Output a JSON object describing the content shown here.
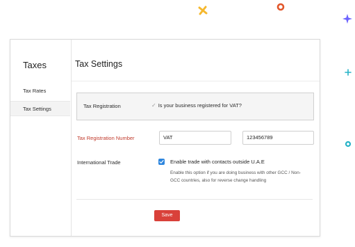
{
  "sidebar": {
    "title": "Taxes",
    "items": [
      {
        "label": "Tax Rates",
        "active": false
      },
      {
        "label": "Tax Settings",
        "active": true
      }
    ]
  },
  "main": {
    "title": "Tax Settings",
    "tax_registration": {
      "label": "Tax Registration",
      "checkbox_label": "Is your business registered for VAT?",
      "checked": true
    },
    "tax_registration_number": {
      "label": "Tax Registration Number",
      "field1_value": "VAT",
      "field2_value": "123456789"
    },
    "international_trade": {
      "label": "International Trade",
      "checkbox_label": "Enable trade with contacts outside U.A.E",
      "checked": true,
      "help_text": "Enable this option if you are doing business with other GCC / Non-GCC countries, also for reverse change handling"
    },
    "save_label": "Save"
  },
  "colors": {
    "accent_red": "#d9413a",
    "label_red": "#c0392b",
    "checkbox_blue": "#2e86de",
    "deco_yellow": "#f5b82e",
    "deco_orange": "#e2572b",
    "deco_purple": "#6c63ff",
    "deco_teal": "#27b3c7"
  },
  "icons": {
    "decorations": [
      "x-sparkle-icon",
      "ring-icon",
      "star-icon",
      "plus-icon",
      "dot-icon"
    ],
    "registration_check": "check-icon",
    "trade_check": "checkbox-checked-icon"
  }
}
